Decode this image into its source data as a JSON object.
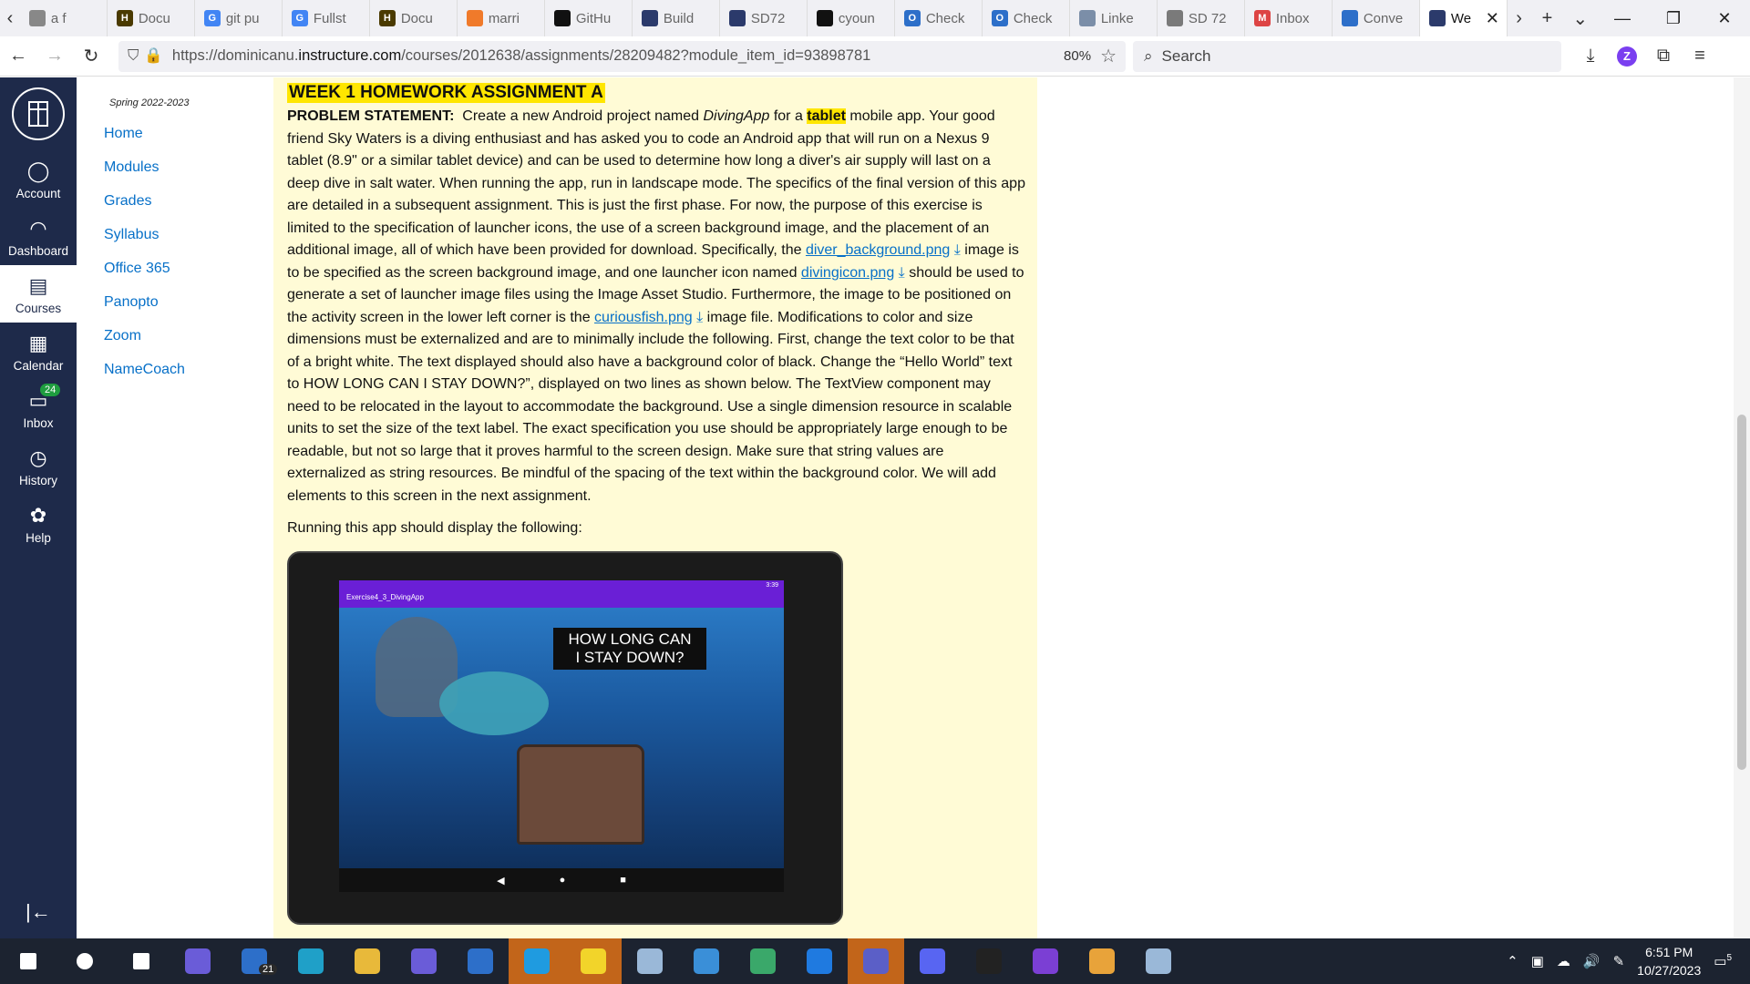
{
  "browser": {
    "tabs": [
      {
        "label": "a f",
        "color": "#888888",
        "glyph": ""
      },
      {
        "label": "Docu",
        "color": "#4a3a00",
        "glyph": "H"
      },
      {
        "label": "git pu",
        "color": "#4285f4",
        "glyph": "G"
      },
      {
        "label": "Fullst",
        "color": "#4285f4",
        "glyph": "G"
      },
      {
        "label": "Docu",
        "color": "#4a3a00",
        "glyph": "H"
      },
      {
        "label": "marri",
        "color": "#f07a2a",
        "glyph": ""
      },
      {
        "label": "GitHu",
        "color": "#111111",
        "glyph": ""
      },
      {
        "label": "Build",
        "color": "#2b3a6b",
        "glyph": ""
      },
      {
        "label": "SD72",
        "color": "#2b3a6b",
        "glyph": ""
      },
      {
        "label": "cyoun",
        "color": "#111111",
        "glyph": ""
      },
      {
        "label": "Check",
        "color": "#2d6fc9",
        "glyph": "O"
      },
      {
        "label": "Check",
        "color": "#2d6fc9",
        "glyph": "O"
      },
      {
        "label": "Linke",
        "color": "#7b8ea8",
        "glyph": ""
      },
      {
        "label": "SD 72",
        "color": "#7a7a7a",
        "glyph": ""
      },
      {
        "label": "Inbox",
        "color": "#d44",
        "glyph": "M"
      },
      {
        "label": "Conve",
        "color": "#2d6fc9",
        "glyph": ""
      },
      {
        "label": "We",
        "color": "#2b3a6b",
        "glyph": ""
      }
    ],
    "url_prefix": "https://dominicanu.",
    "url_host": "instructure.com",
    "url_rest": "/courses/2012638/assignments/28209482?module_item_id=93898781",
    "zoom": "80%",
    "search_placeholder": "Search"
  },
  "global_nav": {
    "items": [
      {
        "label": "Account",
        "icon": "account-icon",
        "glyph": "◯"
      },
      {
        "label": "Dashboard",
        "icon": "dashboard-icon",
        "glyph": "◠"
      },
      {
        "label": "Courses",
        "icon": "courses-icon",
        "glyph": "▤"
      },
      {
        "label": "Calendar",
        "icon": "calendar-icon",
        "glyph": "▦"
      },
      {
        "label": "Inbox",
        "icon": "inbox-icon",
        "glyph": "▭",
        "badge": "24"
      },
      {
        "label": "History",
        "icon": "history-icon",
        "glyph": "◷"
      },
      {
        "label": "Help",
        "icon": "help-icon",
        "glyph": "✿"
      }
    ],
    "collapse_icon": "|←"
  },
  "course_nav": {
    "term": "Spring 2022-2023",
    "items": [
      "Home",
      "Modules",
      "Grades",
      "Syllabus",
      "Office 365",
      "Panopto",
      "Zoom",
      "NameCoach"
    ]
  },
  "assignment": {
    "heading": "WEEK 1 HOMEWORK ASSIGNMENT A",
    "problem_label": "PROBLEM STATEMENT:",
    "p1": "Create a new Android project named ",
    "app_name": "DivingApp",
    "p2": " for a ",
    "tablet_word": "tablet",
    "p3": " mobile app.  Your good friend Sky Waters is a diving enthusiast and has asked you to code an Android app that will run on a Nexus 9 tablet (8.9\" or a similar tablet device) and can be used to determine how long a diver's air supply will last on a deep dive in salt water.  When running the app, run in landscape mode.  The specifics of the final version of this app are detailed in a subsequent assignment.  This is just the first phase.  For now, the purpose of this exercise is limited to the specification of launcher icons, the use of a screen background image, and the placement of an additional image, all of which have been provided for download.  Specifically, the ",
    "link1": "diver_background.png",
    "p4": " image is to be specified as the screen background image, and one launcher icon named ",
    "link2": "divingicon.png",
    "p5": " should be used to generate a set of launcher image files using the Image Asset Studio.  Furthermore, the image to be positioned on the activity screen in the lower left corner is the ",
    "link3": "curiousfish.png",
    "p6": " image file.  Modifications to color and size dimensions must be externalized and are to minimally include the following.  First, change the text color to be that of a bright white.  The text displayed should also have a background color of black.  Change the “Hello World” text to HOW LONG CAN I STAY DOWN?”, displayed on two lines as shown below.  The TextView component may need to be relocated in the layout to accommodate the background.  Use a single dimension resource in scalable units to set the size of the text label.  The exact specification you use should be appropriately large enough to be readable, but not so large that it proves harmful to the screen design.  Make sure that string values are externalized as string resources.  Be mindful of the spacing of the text within the background color. We will add elements to this screen in the next assignment.",
    "running_text": "Running this app should display the following:",
    "screenshot": {
      "app_title": "Exercise4_3_DivingApp",
      "status": "3:39",
      "caption_line1": "HOW LONG CAN",
      "caption_line2": "I STAY DOWN?",
      "nav_back": "◀",
      "nav_home": "●",
      "nav_recent": "■"
    }
  },
  "taskbar": {
    "icons": [
      {
        "name": "windows-start-icon",
        "color": "#ffffff"
      },
      {
        "name": "search-icon",
        "color": "#ffffff"
      },
      {
        "name": "task-view-icon",
        "color": "#ffffff"
      },
      {
        "name": "copilot-icon",
        "color": "#6a5cd8"
      },
      {
        "name": "mail-icon",
        "color": "#2d6fc9",
        "badge": "21"
      },
      {
        "name": "edge-icon",
        "color": "#1fa0c8"
      },
      {
        "name": "file-explorer-icon",
        "color": "#e8b93a"
      },
      {
        "name": "visual-studio-icon",
        "color": "#6a5cd8"
      },
      {
        "name": "store-icon",
        "color": "#2d6fc9"
      },
      {
        "name": "vscode-icon",
        "color": "#1f9be0",
        "highlight": true
      },
      {
        "name": "sticky-notes-icon",
        "color": "#f2d42a",
        "highlight": true
      },
      {
        "name": "notepad-icon",
        "color": "#9ab8d8"
      },
      {
        "name": "photos-icon",
        "color": "#3a8fd8"
      },
      {
        "name": "sourcetree-icon",
        "color": "#3aa86a"
      },
      {
        "name": "power-automate-icon",
        "color": "#1f7ae0"
      },
      {
        "name": "teams-icon",
        "color": "#5b5fc7",
        "highlight": true
      },
      {
        "name": "discord-icon",
        "color": "#5865f2"
      },
      {
        "name": "terminal-icon",
        "color": "#222222"
      },
      {
        "name": "visual-studio-purple-icon",
        "color": "#7b3fd4"
      },
      {
        "name": "chrome-icon",
        "color": "#e8a33a"
      },
      {
        "name": "notepad-plus-icon",
        "color": "#9ab8d8"
      }
    ],
    "time": "6:51 PM",
    "date": "10/27/2023",
    "notifications": "5"
  }
}
